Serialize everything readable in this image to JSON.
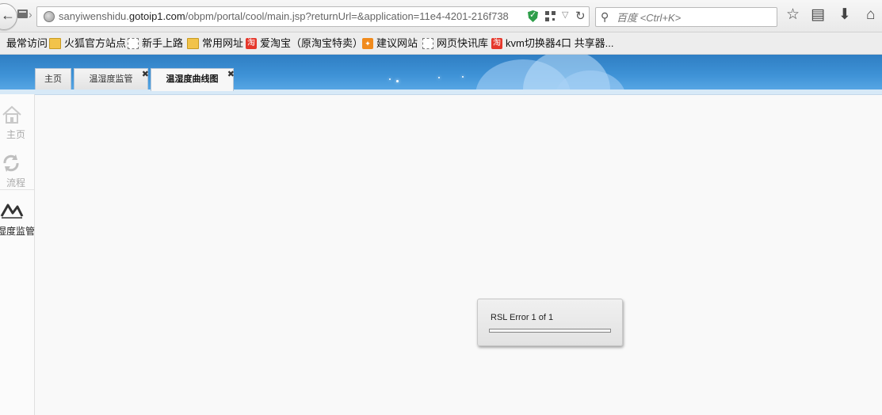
{
  "browser": {
    "url_prefix": "sanyiwenshidu.",
    "url_domain": "gotoip1.com",
    "url_path": "/obpm/portal/cool/main.jsp?returnUrl=&application=11e4-4201-216f738",
    "search_placeholder": "百度 <Ctrl+K>"
  },
  "bookmarks": [
    {
      "label": "最常访问",
      "icon": "gear-icon"
    },
    {
      "label": "火狐官方站点",
      "icon": "folder-icon"
    },
    {
      "label": "新手上路",
      "icon": "page-icon"
    },
    {
      "label": "常用网址",
      "icon": "folder-icon"
    },
    {
      "label": "爱淘宝（原淘宝特卖）",
      "icon": "taobao-icon"
    },
    {
      "label": "建议网站",
      "icon": "bulb-icon"
    },
    {
      "label": "网页快讯库",
      "icon": "page-icon"
    },
    {
      "label": "kvm切换器4口 共享器...",
      "icon": "taobao-icon"
    }
  ],
  "tabs": [
    {
      "label": "主页"
    },
    {
      "label": "温湿度监管"
    },
    {
      "label": "温湿度曲线图"
    }
  ],
  "sidebar": {
    "items": [
      {
        "label": "主页",
        "icon": "home-icon"
      },
      {
        "label": "流程",
        "icon": "process-icon"
      },
      {
        "label": "湿度监管",
        "icon": "chart-line-icon"
      }
    ]
  },
  "dialog": {
    "message": "RSL Error 1 of 1",
    "progress": 0
  }
}
